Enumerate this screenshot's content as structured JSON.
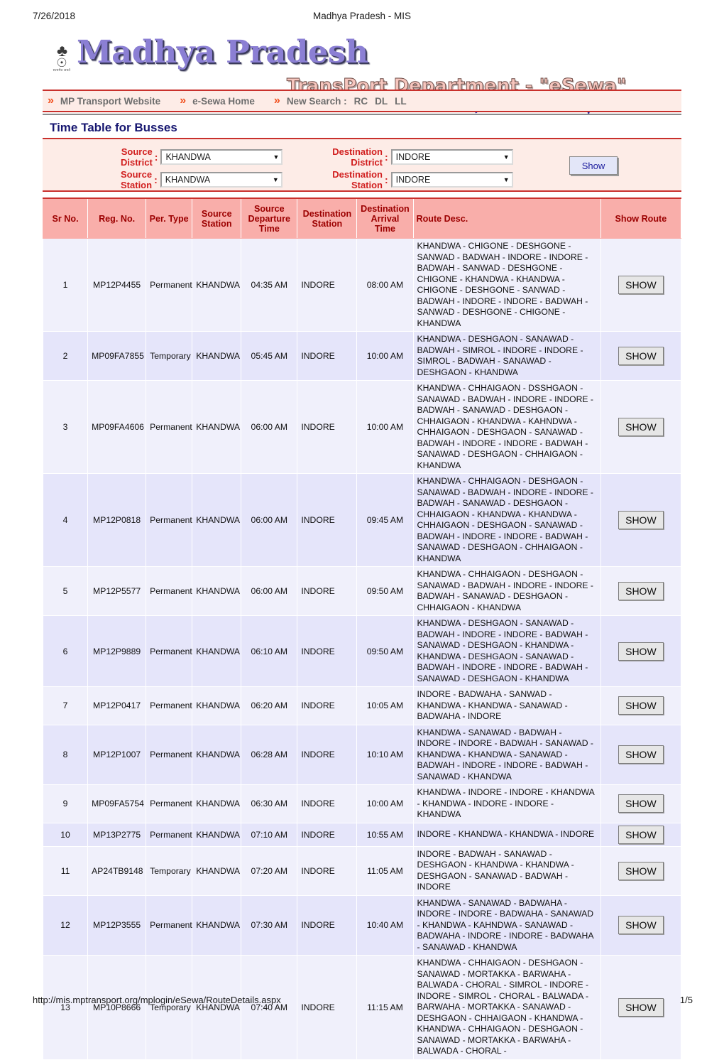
{
  "print": {
    "date": "7/26/2018",
    "doc_title": "Madhya Pradesh - MIS",
    "url": "http://mis.mptransport.org/mplogin/eSewa/RouteDetails.aspx",
    "page_number": "1/5"
  },
  "banner": {
    "emblem_text": "सत्यमेव जयते",
    "title_state": "Madhya Pradesh",
    "title_dept": "TransPort Department - \"eSewa\"",
    "tagline_hindi": "ई - गर्वनेंस की तरफ बढ़ते कदम"
  },
  "nav": {
    "chevron": "»",
    "items": [
      {
        "label": "MP Transport Website"
      },
      {
        "label": "e-Sewa Home"
      },
      {
        "label": "New Search :"
      }
    ],
    "search_links": [
      "RC",
      "DL",
      "LL"
    ]
  },
  "page_title": "Time Table for Busses",
  "search_form": {
    "source_district": {
      "label_line1": "Source",
      "label_line2": "District",
      "value": "KHANDWA"
    },
    "source_station": {
      "label_line1": "Source",
      "label_line2": "Station",
      "value": "KHANDWA"
    },
    "destination_district": {
      "label_line1": "Destination",
      "label_line2": "District",
      "value": "INDORE"
    },
    "destination_station": {
      "label_line1": "Destination",
      "label_line2": "Station",
      "value": "INDORE"
    },
    "colon": ":",
    "dropdown_arrow": "▼",
    "show_button": "Show"
  },
  "table": {
    "headers": {
      "sr_no": "Sr No.",
      "reg_no": "Reg. No.",
      "per_type": "Per. Type",
      "source_station": "Source Station",
      "source_departure_time": "Source Departure Time",
      "destination_station": "Destination Station",
      "destination_arrival_time": "Destination Arrival Time",
      "route_desc": "Route Desc.",
      "show_route": "Show Route"
    },
    "row_button_label": "SHOW",
    "rows": [
      {
        "sr_no": "1",
        "reg_no": "MP12P4455",
        "per_type": "Permanent",
        "source_station": "KHANDWA",
        "source_departure_time": "04:35 AM",
        "destination_station": "INDORE",
        "destination_arrival_time": "08:00 AM",
        "route_desc": "KHANDWA - CHIGONE - DESHGONE - SANWAD - BADWAH - INDORE - INDORE - BADWAH - SANWAD - DESHGONE - CHIGONE - KHANDWA - KHANDWA - CHIGONE - DESHGONE - SANWAD - BADWAH - INDORE - INDORE - BADWAH - SANWAD - DESHGONE - CHIGONE - KHANDWA"
      },
      {
        "sr_no": "2",
        "reg_no": "MP09FA7855",
        "per_type": "Temporary",
        "source_station": "KHANDWA",
        "source_departure_time": "05:45 AM",
        "destination_station": "INDORE",
        "destination_arrival_time": "10:00 AM",
        "route_desc": "KHANDWA - DESHGAON - SANAWAD - BADWAH - SIMROL - INDORE - INDORE - SIMROL - BADWAH - SANAWAD - DESHGAON - KHANDWA"
      },
      {
        "sr_no": "3",
        "reg_no": "MP09FA4606",
        "per_type": "Permanent",
        "source_station": "KHANDWA",
        "source_departure_time": "06:00 AM",
        "destination_station": "INDORE",
        "destination_arrival_time": "10:00 AM",
        "route_desc": "KHANDWA - CHHAIGAON - DSSHGAON - SANAWAD - BADWAH - INDORE - INDORE - BADWAH - SANAWAD - DESHGAON - CHHAIGAON - KHANDWA - KAHNDWA - CHHAIGAON - DESHGAON - SANAWAD - BADWAH - INDORE - INDORE - BADWAH - SANAWAD - DESHGAON - CHHAIGAON - KHANDWA"
      },
      {
        "sr_no": "4",
        "reg_no": "MP12P0818",
        "per_type": "Permanent",
        "source_station": "KHANDWA",
        "source_departure_time": "06:00 AM",
        "destination_station": "INDORE",
        "destination_arrival_time": "09:45 AM",
        "route_desc": "KHANDWA - CHHAIGAON - DESHGAON - SANAWAD - BADWAH - INDORE - INDORE - BADWAH - SANAWAD - DESHGAON - CHHAIGAON - KHANDWA - KHANDWA - CHHAIGAON - DESHGAON - SANAWAD - BADWAH - INDORE - INDORE - BADWAH - SANAWAD - DESHGAON - CHHAIGAON - KHANDWA"
      },
      {
        "sr_no": "5",
        "reg_no": "MP12P5577",
        "per_type": "Permanent",
        "source_station": "KHANDWA",
        "source_departure_time": "06:00 AM",
        "destination_station": "INDORE",
        "destination_arrival_time": "09:50 AM",
        "route_desc": "KHANDWA - CHHAIGAON - DESHGAON - SANAWAD - BADWAH - INDORE - INDORE - BADWAH - SANAWAD - DESHGAON - CHHAIGAON - KHANDWA"
      },
      {
        "sr_no": "6",
        "reg_no": "MP12P9889",
        "per_type": "Permanent",
        "source_station": "KHANDWA",
        "source_departure_time": "06:10 AM",
        "destination_station": "INDORE",
        "destination_arrival_time": "09:50 AM",
        "route_desc": "KHANDWA - DESHGAON - SANAWAD - BADWAH - INDORE - INDORE - BADWAH - SANAWAD - DESHGAON - KHANDWA - KHANDWA - DESHGAON - SANAWAD - BADWAH - INDORE - INDORE - BADWAH - SANAWAD - DESHGAON - KHANDWA"
      },
      {
        "sr_no": "7",
        "reg_no": "MP12P0417",
        "per_type": "Permanent",
        "source_station": "KHANDWA",
        "source_departure_time": "06:20 AM",
        "destination_station": "INDORE",
        "destination_arrival_time": "10:05 AM",
        "route_desc": "INDORE - BADWAHA - SANWAD - KHANDWA - KHANDWA - SANAWAD - BADWAHA - INDORE"
      },
      {
        "sr_no": "8",
        "reg_no": "MP12P1007",
        "per_type": "Permanent",
        "source_station": "KHANDWA",
        "source_departure_time": "06:28 AM",
        "destination_station": "INDORE",
        "destination_arrival_time": "10:10 AM",
        "route_desc": "KHANDWA - SANAWAD - BADWAH - INDORE - INDORE - BADWAH - SANAWAD - KHANDWA - KHANDWA - SANAWAD - BADWAH - INDORE - INDORE - BADWAH - SANAWAD - KHANDWA"
      },
      {
        "sr_no": "9",
        "reg_no": "MP09FA5754",
        "per_type": "Permanent",
        "source_station": "KHANDWA",
        "source_departure_time": "06:30 AM",
        "destination_station": "INDORE",
        "destination_arrival_time": "10:00 AM",
        "route_desc": "KHANDWA - INDORE - INDORE - KHANDWA - KHANDWA - INDORE - INDORE - KHANDWA"
      },
      {
        "sr_no": "10",
        "reg_no": "MP13P2775",
        "per_type": "Permanent",
        "source_station": "KHANDWA",
        "source_departure_time": "07:10 AM",
        "destination_station": "INDORE",
        "destination_arrival_time": "10:55 AM",
        "route_desc": "INDORE - KHANDWA - KHANDWA - INDORE"
      },
      {
        "sr_no": "11",
        "reg_no": "AP24TB9148",
        "per_type": "Temporary",
        "source_station": "KHANDWA",
        "source_departure_time": "07:20 AM",
        "destination_station": "INDORE",
        "destination_arrival_time": "11:05 AM",
        "route_desc": "INDORE - BADWAH - SANAWAD - DESHGAON - KHANDWA - KHANDWA - DESHGAON - SANAWAD - BADWAH - INDORE"
      },
      {
        "sr_no": "12",
        "reg_no": "MP12P3555",
        "per_type": "Permanent",
        "source_station": "KHANDWA",
        "source_departure_time": "07:30 AM",
        "destination_station": "INDORE",
        "destination_arrival_time": "10:40 AM",
        "route_desc": "KHANDWA - SANAWAD - BADWAHA - INDORE - INDORE - BADWAHA - SANAWAD - KHANDWA - KAHNDWA - SANAWAD - BADWAHA - INDORE - INDORE - BADWAHA - SANAWAD - KHANDWA"
      },
      {
        "sr_no": "13",
        "reg_no": "MP10P8666",
        "per_type": "Temporary",
        "source_station": "KHANDWA",
        "source_departure_time": "07:40 AM",
        "destination_station": "INDORE",
        "destination_arrival_time": "11:15 AM",
        "route_desc": "KHANDWA - CHHAIGAON - DESHGAON - SANAWAD - MORTAKKA - BARWAHA - BALWADA - CHORAL - SIMROL - INDORE - INDORE - SIMROL - CHORAL - BALWADA - BARWAHA - MORTAKKA - SANAWAD - DESHGAON - CHHAIGAON - KHANDWA - KHANDWA - CHHAIGAON - DESHGAON - SANAWAD - MORTAKKA - BARWAHA - BALWADA - CHORAL -"
      }
    ]
  },
  "colors": {
    "header_band": "#f9aeaa",
    "header_text": "#9c0000",
    "rule": "#c9302c",
    "panel_bg": "#fdece7",
    "row_odd": "#f0f0fb",
    "row_even": "#e5e5fa",
    "title_blue": "#161670",
    "label_red": "#d11f1f",
    "nav_chevron": "#f2501e"
  }
}
